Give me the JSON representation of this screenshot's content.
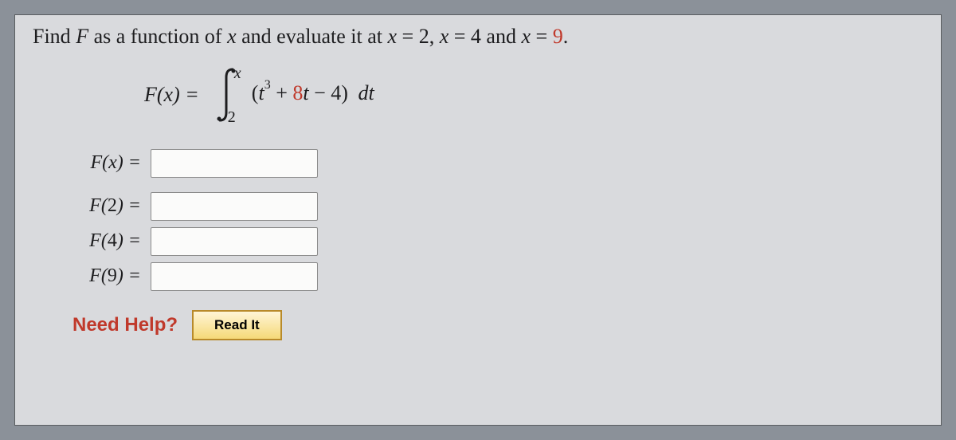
{
  "question": {
    "prefix": "Find ",
    "F": "F",
    "mid1": " as a function of ",
    "x1": "x",
    "mid2": " and evaluate it at ",
    "x2": "x",
    "eq2": " = 2, ",
    "x3": "x",
    "eq4": " = 4 and ",
    "x4": "x",
    "eq9a": " = ",
    "nine": "9",
    "period": "."
  },
  "equation": {
    "lhs": "F(x) =",
    "upper": "x",
    "lower": "2",
    "open": "(",
    "t": "t",
    "cube": "3",
    "plus": " + ",
    "eight": "8",
    "t2": "t",
    "minus": " − ",
    "four": "4",
    "close": ")",
    "dt": " dt"
  },
  "labels": {
    "fx": "F(x) =",
    "f2a": "F(",
    "f2n": "2",
    "f2b": ") =",
    "f4a": "F(",
    "f4n": "4",
    "f4b": ") =",
    "f9a": "F(",
    "f9n": "9",
    "f9b": ") ="
  },
  "help": {
    "label": "Need Help?",
    "read": "Read It"
  }
}
